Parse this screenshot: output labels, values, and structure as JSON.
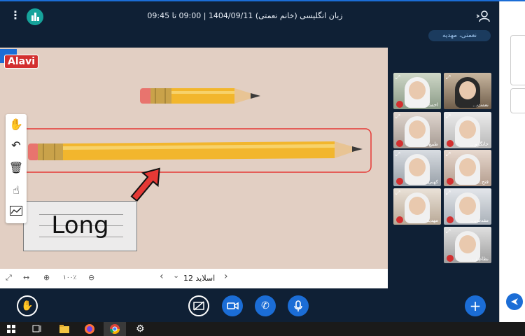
{
  "header": {
    "title": "زبان انگلیسی (خانم نعمتی) 1404/09/11 | 09:00 تا 09:45",
    "menu_icon": "dots-vertical-icon",
    "stats_icon": "bar-chart-icon",
    "user_icon": "user-icon"
  },
  "presenter": {
    "label": "نعمتی، مهدیه"
  },
  "slide": {
    "badge": "Alavi",
    "card_word": "Long",
    "minimize_label": "–"
  },
  "toolbar": {
    "tools": [
      "hand-icon",
      "undo-icon",
      "trash-icon",
      "pointer-hand-icon",
      "chart-line-icon"
    ]
  },
  "zoom": {
    "fit_icon": "expand-icon",
    "width_icon": "arrows-horizontal-icon",
    "zoom_in_icon": "zoom-in-icon",
    "zoom_value": "۱۰۰٪",
    "zoom_out_icon": "zoom-out-icon"
  },
  "slides": {
    "label": "اسلاید 12",
    "prev": "‹",
    "next": "›",
    "dropdown": "⌄"
  },
  "participants": [
    {
      "name": "احمد..."
    },
    {
      "name": "نعمت..."
    },
    {
      "name": "طبیع..."
    },
    {
      "name": "جانگرو..."
    },
    {
      "name": "کهنی..."
    },
    {
      "name": "فتح..."
    },
    {
      "name": "مهدیه"
    },
    {
      "name": "مقدس..."
    },
    {
      "name": "نظام ز..."
    }
  ],
  "controls": {
    "raise_hand": "raise-hand-icon",
    "screen_share": "screen-share-off-icon",
    "video": "video-camera-icon",
    "phone": "phone-icon",
    "mic": "microphone-icon",
    "add": "plus-icon"
  },
  "colors": {
    "accent": "#1b6dd6",
    "teal": "#16a39b",
    "alert": "#d32f2f",
    "background": "#0f2035"
  }
}
